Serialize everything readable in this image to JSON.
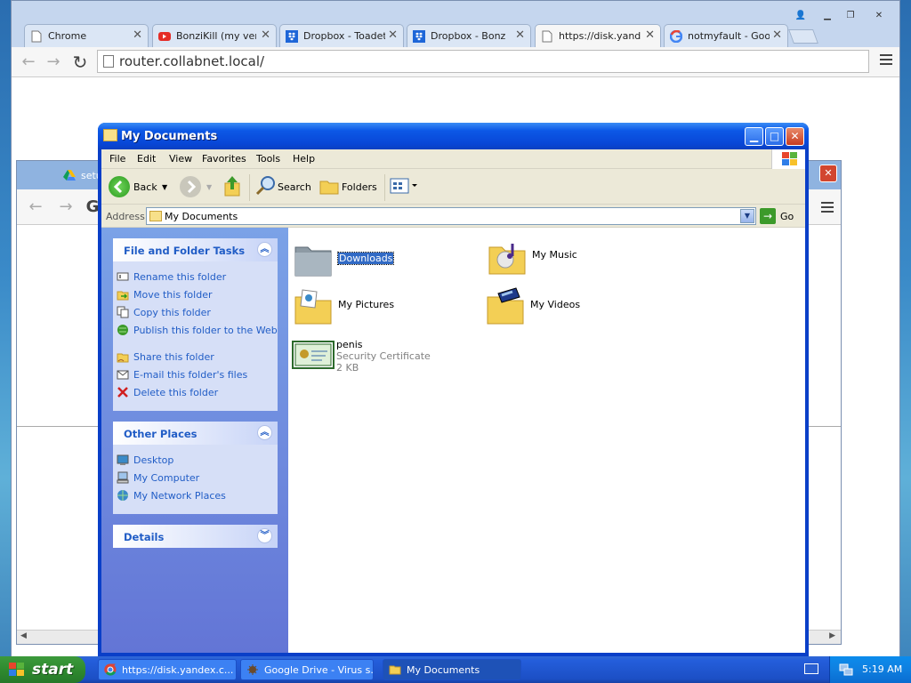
{
  "chrome": {
    "tabs": [
      {
        "label": "Chrome",
        "active": false,
        "icon": "page-icon"
      },
      {
        "label": "BonziKill (my versio",
        "active": false,
        "icon": "youtube-icon"
      },
      {
        "label": "Dropbox - Toadette",
        "active": false,
        "icon": "dropbox-icon"
      },
      {
        "label": "Dropbox - BonziKill",
        "active": false,
        "icon": "dropbox-icon"
      },
      {
        "label": "https://disk.yandex",
        "active": true,
        "icon": "page-icon"
      },
      {
        "label": "notmyfault - Googl",
        "active": false,
        "icon": "google-icon"
      }
    ],
    "url": "router.collabnet.local/",
    "close_glyph": "✕"
  },
  "chrome2": {
    "tab_label": "setu"
  },
  "explorer": {
    "title": "My Documents",
    "menu": [
      "File",
      "Edit",
      "View",
      "Favorites",
      "Tools",
      "Help"
    ],
    "toolbar": {
      "back": "Back",
      "search": "Search",
      "folders": "Folders"
    },
    "address_label": "Address",
    "address_value": "My Documents",
    "go_label": "Go",
    "panels": {
      "tasks": {
        "title": "File and Folder Tasks",
        "items": [
          "Rename this folder",
          "Move this folder",
          "Copy this folder",
          "Publish this folder to the Web",
          "Share this folder",
          "E-mail this folder's files",
          "Delete this folder"
        ]
      },
      "places": {
        "title": "Other Places",
        "items": [
          "Desktop",
          "My Computer",
          "My Network Places"
        ]
      },
      "details": {
        "title": "Details"
      }
    },
    "files": [
      {
        "name": "Downloads",
        "selected": true,
        "icon": "folder-icon"
      },
      {
        "name": "My Music",
        "selected": false,
        "icon": "music-folder-icon"
      },
      {
        "name": "My Pictures",
        "selected": false,
        "icon": "pictures-folder-icon"
      },
      {
        "name": "My Videos",
        "selected": false,
        "icon": "videos-folder-icon"
      },
      {
        "name": "penis",
        "type": "Security Certificate",
        "size": "2 KB",
        "icon": "certificate-icon"
      }
    ]
  },
  "taskbar": {
    "start": "start",
    "tasks": [
      {
        "label": "https://disk.yandex.c...",
        "active": false
      },
      {
        "label": "Google Drive - Virus s...",
        "active": false
      },
      {
        "label": "My Documents",
        "active": true
      }
    ],
    "clock": "5:19 AM"
  },
  "colors": {
    "xp_blue": "#0a3fc8",
    "panel_link": "#215dc6",
    "start_green": "#3c9a3c",
    "selection": "#316ac5"
  }
}
